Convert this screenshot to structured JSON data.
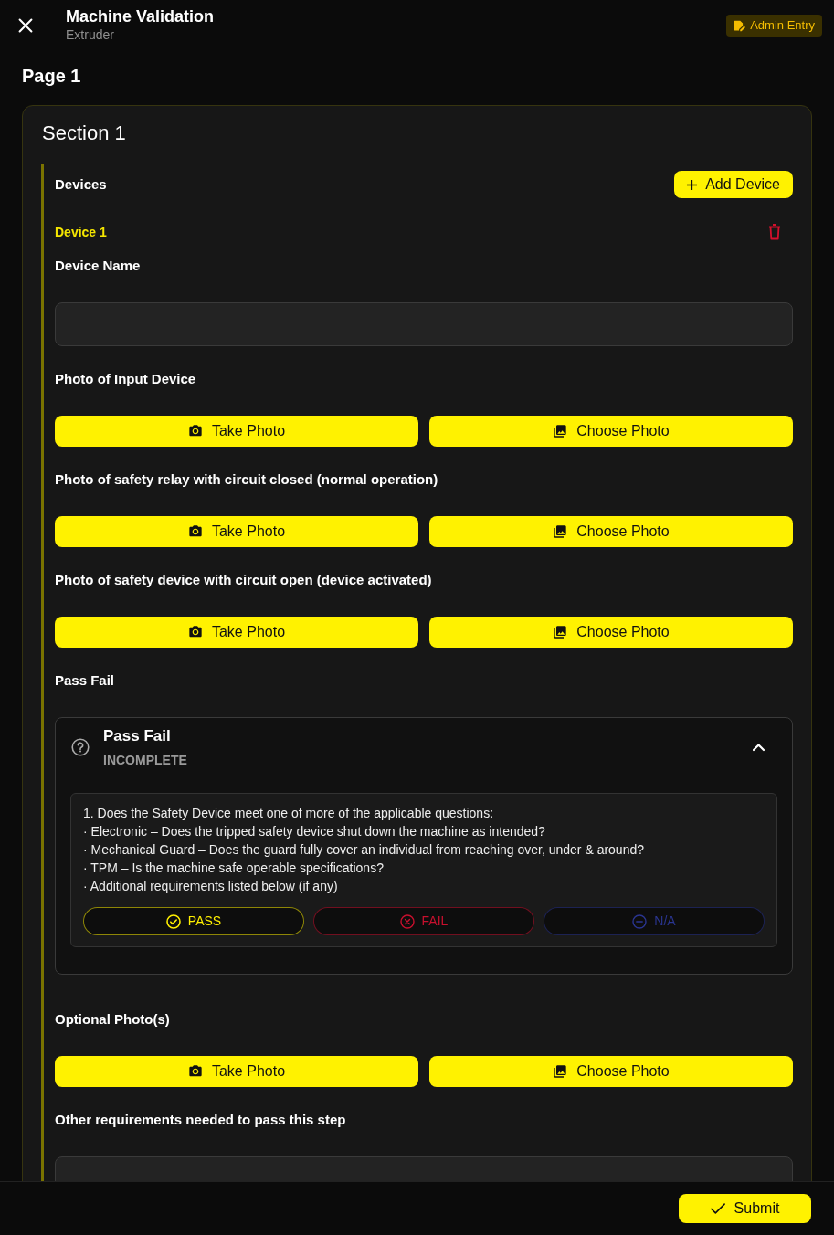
{
  "header": {
    "title": "Machine Validation",
    "subtitle": "Extruder",
    "admin_button": "Admin Entry"
  },
  "page_title": "Page 1",
  "section": {
    "title": "Section 1",
    "devices_label": "Devices",
    "add_button": "Add Device",
    "devices": [
      {
        "label": "Device 1",
        "fields": [
          {
            "kind": "text",
            "label": "Device Name"
          },
          {
            "kind": "photo",
            "label": "Photo of Input Device",
            "take_button": "Take Photo",
            "choose_button": "Choose Photo"
          },
          {
            "kind": "photo",
            "label": "Photo of safety relay with circuit closed (normal operation)",
            "take_button": "Take Photo",
            "choose_button": "Choose Photo"
          },
          {
            "kind": "photo",
            "label": "Photo of safety device with circuit open (device activated)",
            "take_button": "Take Photo",
            "choose_button": "Choose Photo"
          },
          {
            "kind": "pass_fail",
            "label": "Pass Fail",
            "card": {
              "title": "Pass Fail",
              "status": "INCOMPLETE",
              "expanded": true,
              "question": "1. Does the Safety Device meet one of more of the applicable questions:",
              "criteria": [
                "· Electronic – Does the tripped safety device shut down the machine as intended?",
                "· Mechanical Guard – Does the guard fully cover an individual from reaching over, under & around?",
                "· TPM – Is the machine safe operable specifications?",
                "· Additional requirements listed below (if any)"
              ],
              "options": [
                {
                  "kind": "pass",
                  "label": "PASS",
                  "color": "#fff000"
                },
                {
                  "kind": "fail",
                  "label": "FAIL",
                  "color": "#c8102e"
                },
                {
                  "kind": "na",
                  "label": "N/A",
                  "color": "#2a3590"
                }
              ]
            }
          },
          {
            "kind": "photo",
            "label": "Optional Photo(s)",
            "take_button": "Take Photo",
            "choose_button": "Choose Photo"
          },
          {
            "kind": "text",
            "label": "Other requirements needed to pass this step"
          }
        ]
      }
    ]
  },
  "footer": {
    "submit_button": "Submit"
  }
}
